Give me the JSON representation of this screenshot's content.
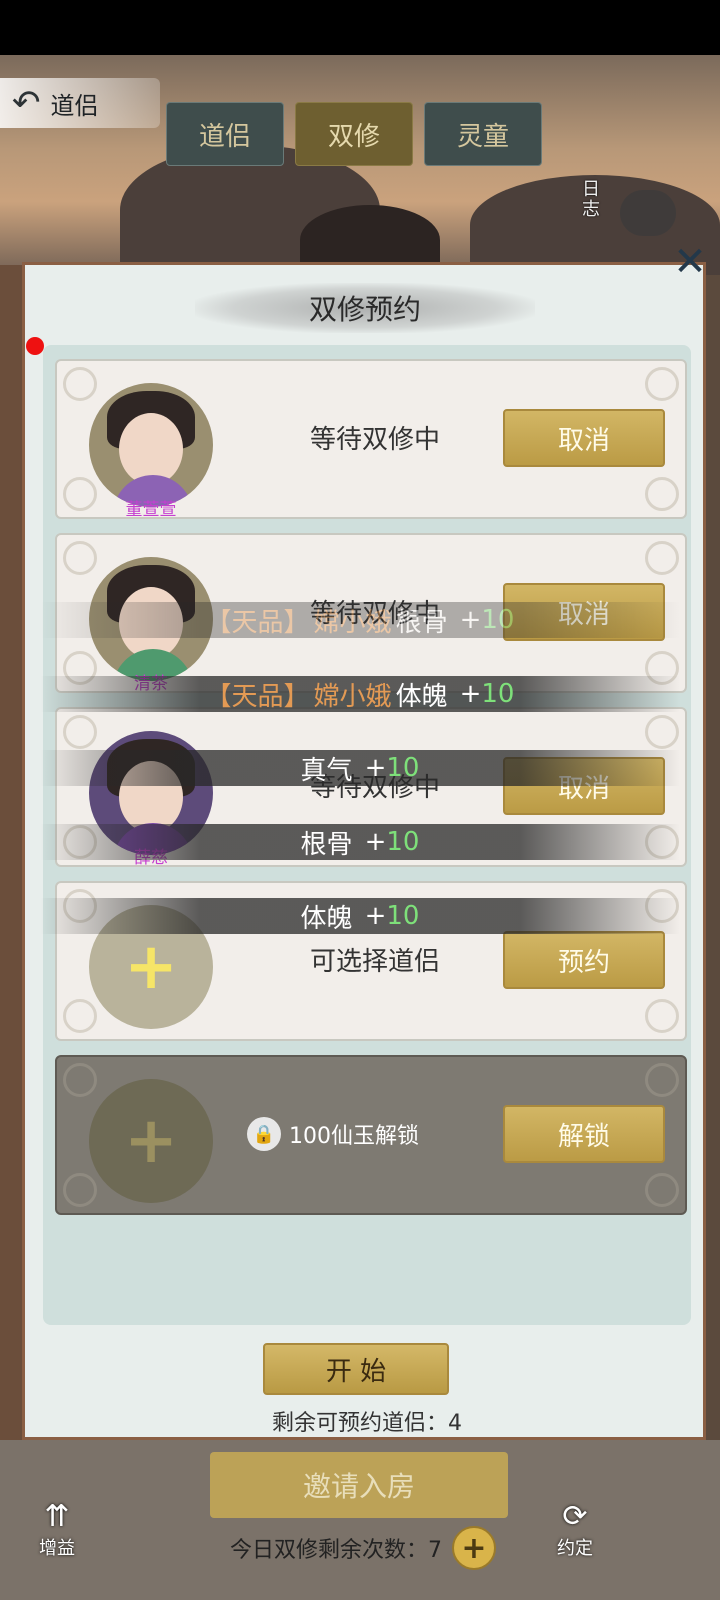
{
  "header": {
    "back_label": "道侣",
    "tabs": [
      {
        "label": "道侣"
      },
      {
        "label": "双修"
      },
      {
        "label": "灵童"
      }
    ],
    "diary_label": "日志"
  },
  "panel": {
    "title": "双修预约",
    "slots": [
      {
        "name": "董萱萱",
        "status": "等待双修中",
        "button": "取消"
      },
      {
        "name": "清茶",
        "status": "等待双修中",
        "button": "取消"
      },
      {
        "name": "薛慈",
        "status": "等待双修中",
        "button": "取消"
      },
      {
        "name": "",
        "status": "可选择道侣",
        "button": "预约"
      },
      {
        "name": "",
        "status": "100仙玉解锁",
        "button": "解锁"
      }
    ],
    "start_label": "开 始",
    "remaining_text": "剩余可预约道侣：4"
  },
  "floating_texts": [
    {
      "quality": "【天品】",
      "who": "嫦小娥",
      "attr": "根骨",
      "plus": "+",
      "num": "10"
    },
    {
      "quality": "【天品】",
      "who": "嫦小娥",
      "attr": "体魄",
      "plus": "+",
      "num": "10"
    },
    {
      "quality": "",
      "who": "",
      "attr": "真气",
      "plus": "+",
      "num": "10"
    },
    {
      "quality": "",
      "who": "",
      "attr": "根骨",
      "plus": "+",
      "num": "10"
    },
    {
      "quality": "",
      "who": "",
      "attr": "体魄",
      "plus": "+",
      "num": "10"
    }
  ],
  "bottom": {
    "invite_label": "邀请入房",
    "bonus_label": "增益",
    "contract_label": "约定",
    "today_text": "今日双修剩余次数：7"
  },
  "icons": {
    "back": "back-arrow-icon",
    "close": "close-icon",
    "add": "plus-icon",
    "lock": "lock-icon"
  }
}
